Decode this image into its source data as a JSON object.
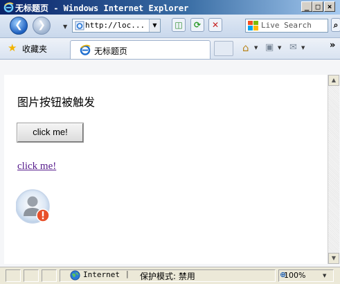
{
  "window": {
    "title": "无标题页 - Windows Internet Explorer",
    "minimize": "_",
    "maximize": "□",
    "close": "×"
  },
  "address_bar": {
    "url": "http://loc...",
    "search_placeholder": "Live Search"
  },
  "favorites": {
    "label": "收藏夹",
    "tab_title": "无标题页",
    "more": "»"
  },
  "page": {
    "message": "图片按钮被触发",
    "button_label": "click me!",
    "link_label": "click me!"
  },
  "status_bar": {
    "zone": "Internet",
    "separator": "|",
    "protected_mode": "保护模式: 禁用",
    "zoom": "100%"
  }
}
